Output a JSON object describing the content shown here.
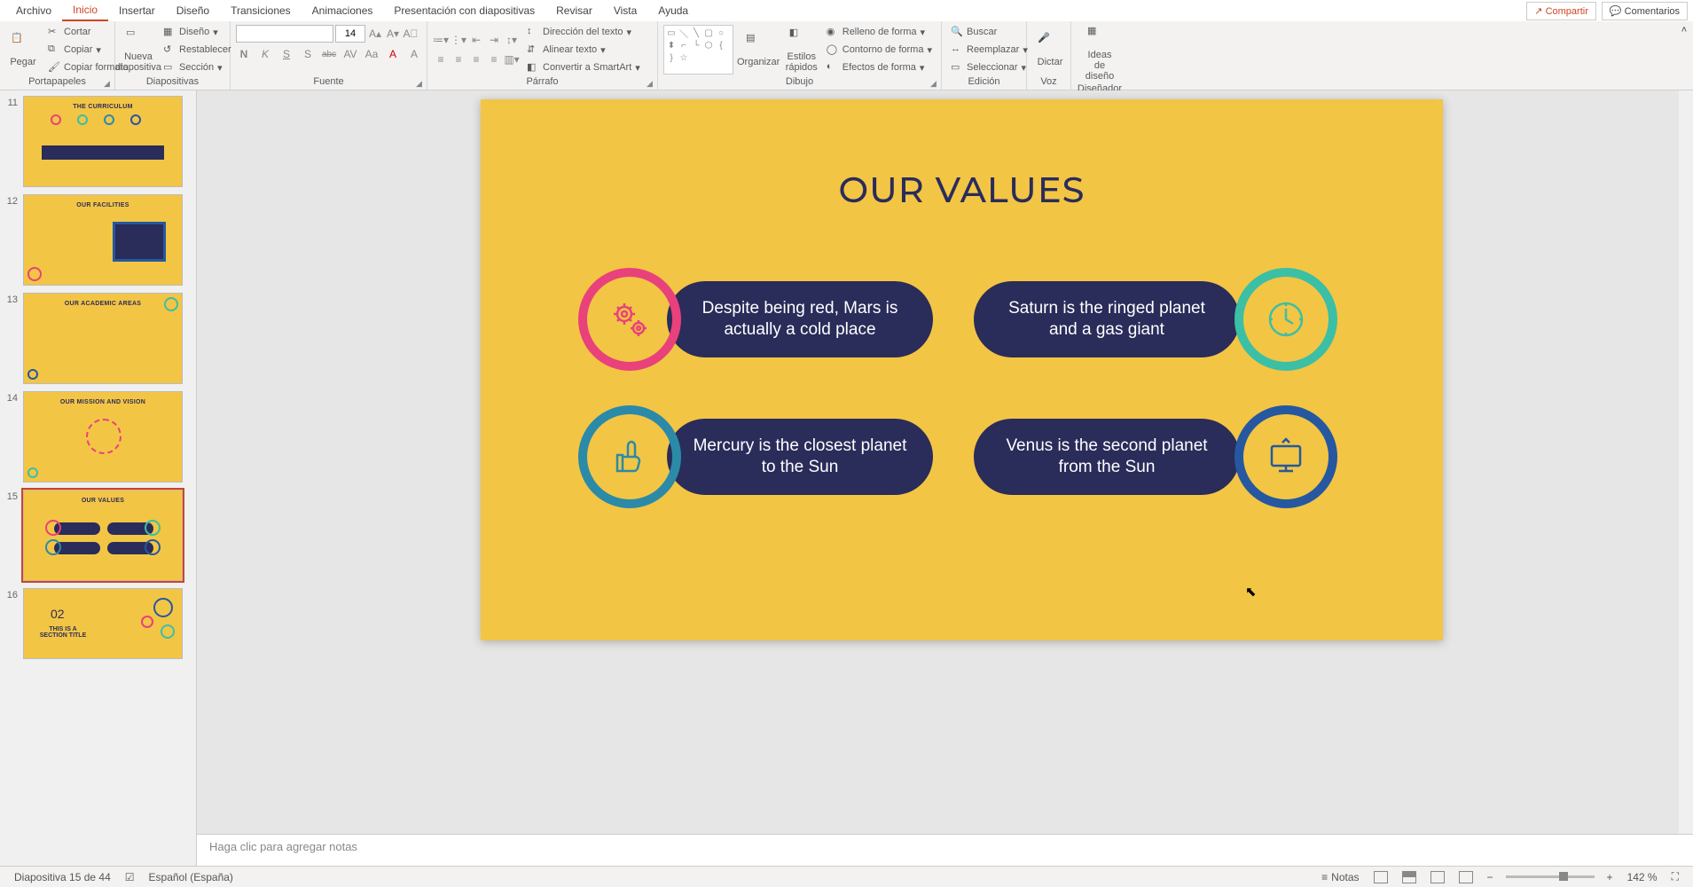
{
  "menu": {
    "tabs": [
      "Archivo",
      "Inicio",
      "Insertar",
      "Diseño",
      "Transiciones",
      "Animaciones",
      "Presentación con diapositivas",
      "Revisar",
      "Vista",
      "Ayuda"
    ],
    "active_index": 1,
    "share": "Compartir",
    "comments": "Comentarios"
  },
  "ribbon": {
    "clipboard": {
      "label": "Portapapeles",
      "paste": "Pegar",
      "cut": "Cortar",
      "copy": "Copiar",
      "format_painter": "Copiar formato"
    },
    "slides": {
      "label": "Diapositivas",
      "new_slide": "Nueva\ndiapositiva",
      "layout": "Diseño",
      "reset": "Restablecer",
      "section": "Sección"
    },
    "font": {
      "label": "Fuente",
      "font_name": "",
      "font_size": "14",
      "buttons": [
        "N",
        "K",
        "S",
        "S",
        "abc",
        "AV",
        "Aa",
        "A",
        "A"
      ]
    },
    "paragraph": {
      "label": "Párrafo",
      "text_dir": "Dirección del texto",
      "align_text": "Alinear texto",
      "smartart": "Convertir a SmartArt"
    },
    "drawing": {
      "label": "Dibujo",
      "arrange": "Organizar",
      "quick_styles": "Estilos\nrápidos",
      "fill": "Relleno de forma",
      "outline": "Contorno de forma",
      "effects": "Efectos de forma"
    },
    "editing": {
      "label": "Edición",
      "find": "Buscar",
      "replace": "Reemplazar",
      "select": "Seleccionar"
    },
    "voice": {
      "label": "Voz",
      "dictate": "Dictar"
    },
    "designer": {
      "label": "Diseñador",
      "ideas": "Ideas de\ndiseño"
    }
  },
  "thumbnails": {
    "items": [
      {
        "num": 11,
        "title": "THE CURRICULUM"
      },
      {
        "num": 12,
        "title": "OUR FACILITIES"
      },
      {
        "num": 13,
        "title": "OUR ACADEMIC AREAS"
      },
      {
        "num": 14,
        "title": "OUR MISSION AND VISION"
      },
      {
        "num": 15,
        "title": "OUR VALUES"
      },
      {
        "num": 16,
        "title": "THIS IS A\nSECTION TITLE"
      }
    ],
    "selected_index": 4
  },
  "slide": {
    "title": "OUR VALUES",
    "values": [
      {
        "text": "Despite being red, Mars is actually a cold place",
        "icon": "gears",
        "color": "pink",
        "side": "left"
      },
      {
        "text": "Saturn is the ringed planet and a gas giant",
        "icon": "clock",
        "color": "teal",
        "side": "right"
      },
      {
        "text": "Mercury is the closest planet to the Sun",
        "icon": "thumbs-up",
        "color": "blue",
        "side": "left"
      },
      {
        "text": "Venus is the second planet from the Sun",
        "icon": "monitor",
        "color": "navy",
        "side": "right"
      }
    ]
  },
  "notes": {
    "placeholder": "Haga clic para agregar notas"
  },
  "statusbar": {
    "slide_info": "Diapositiva 15 de 44",
    "language": "Español (España)",
    "notes_label": "Notas",
    "zoom_percent": "142 %"
  },
  "chart_data": null
}
